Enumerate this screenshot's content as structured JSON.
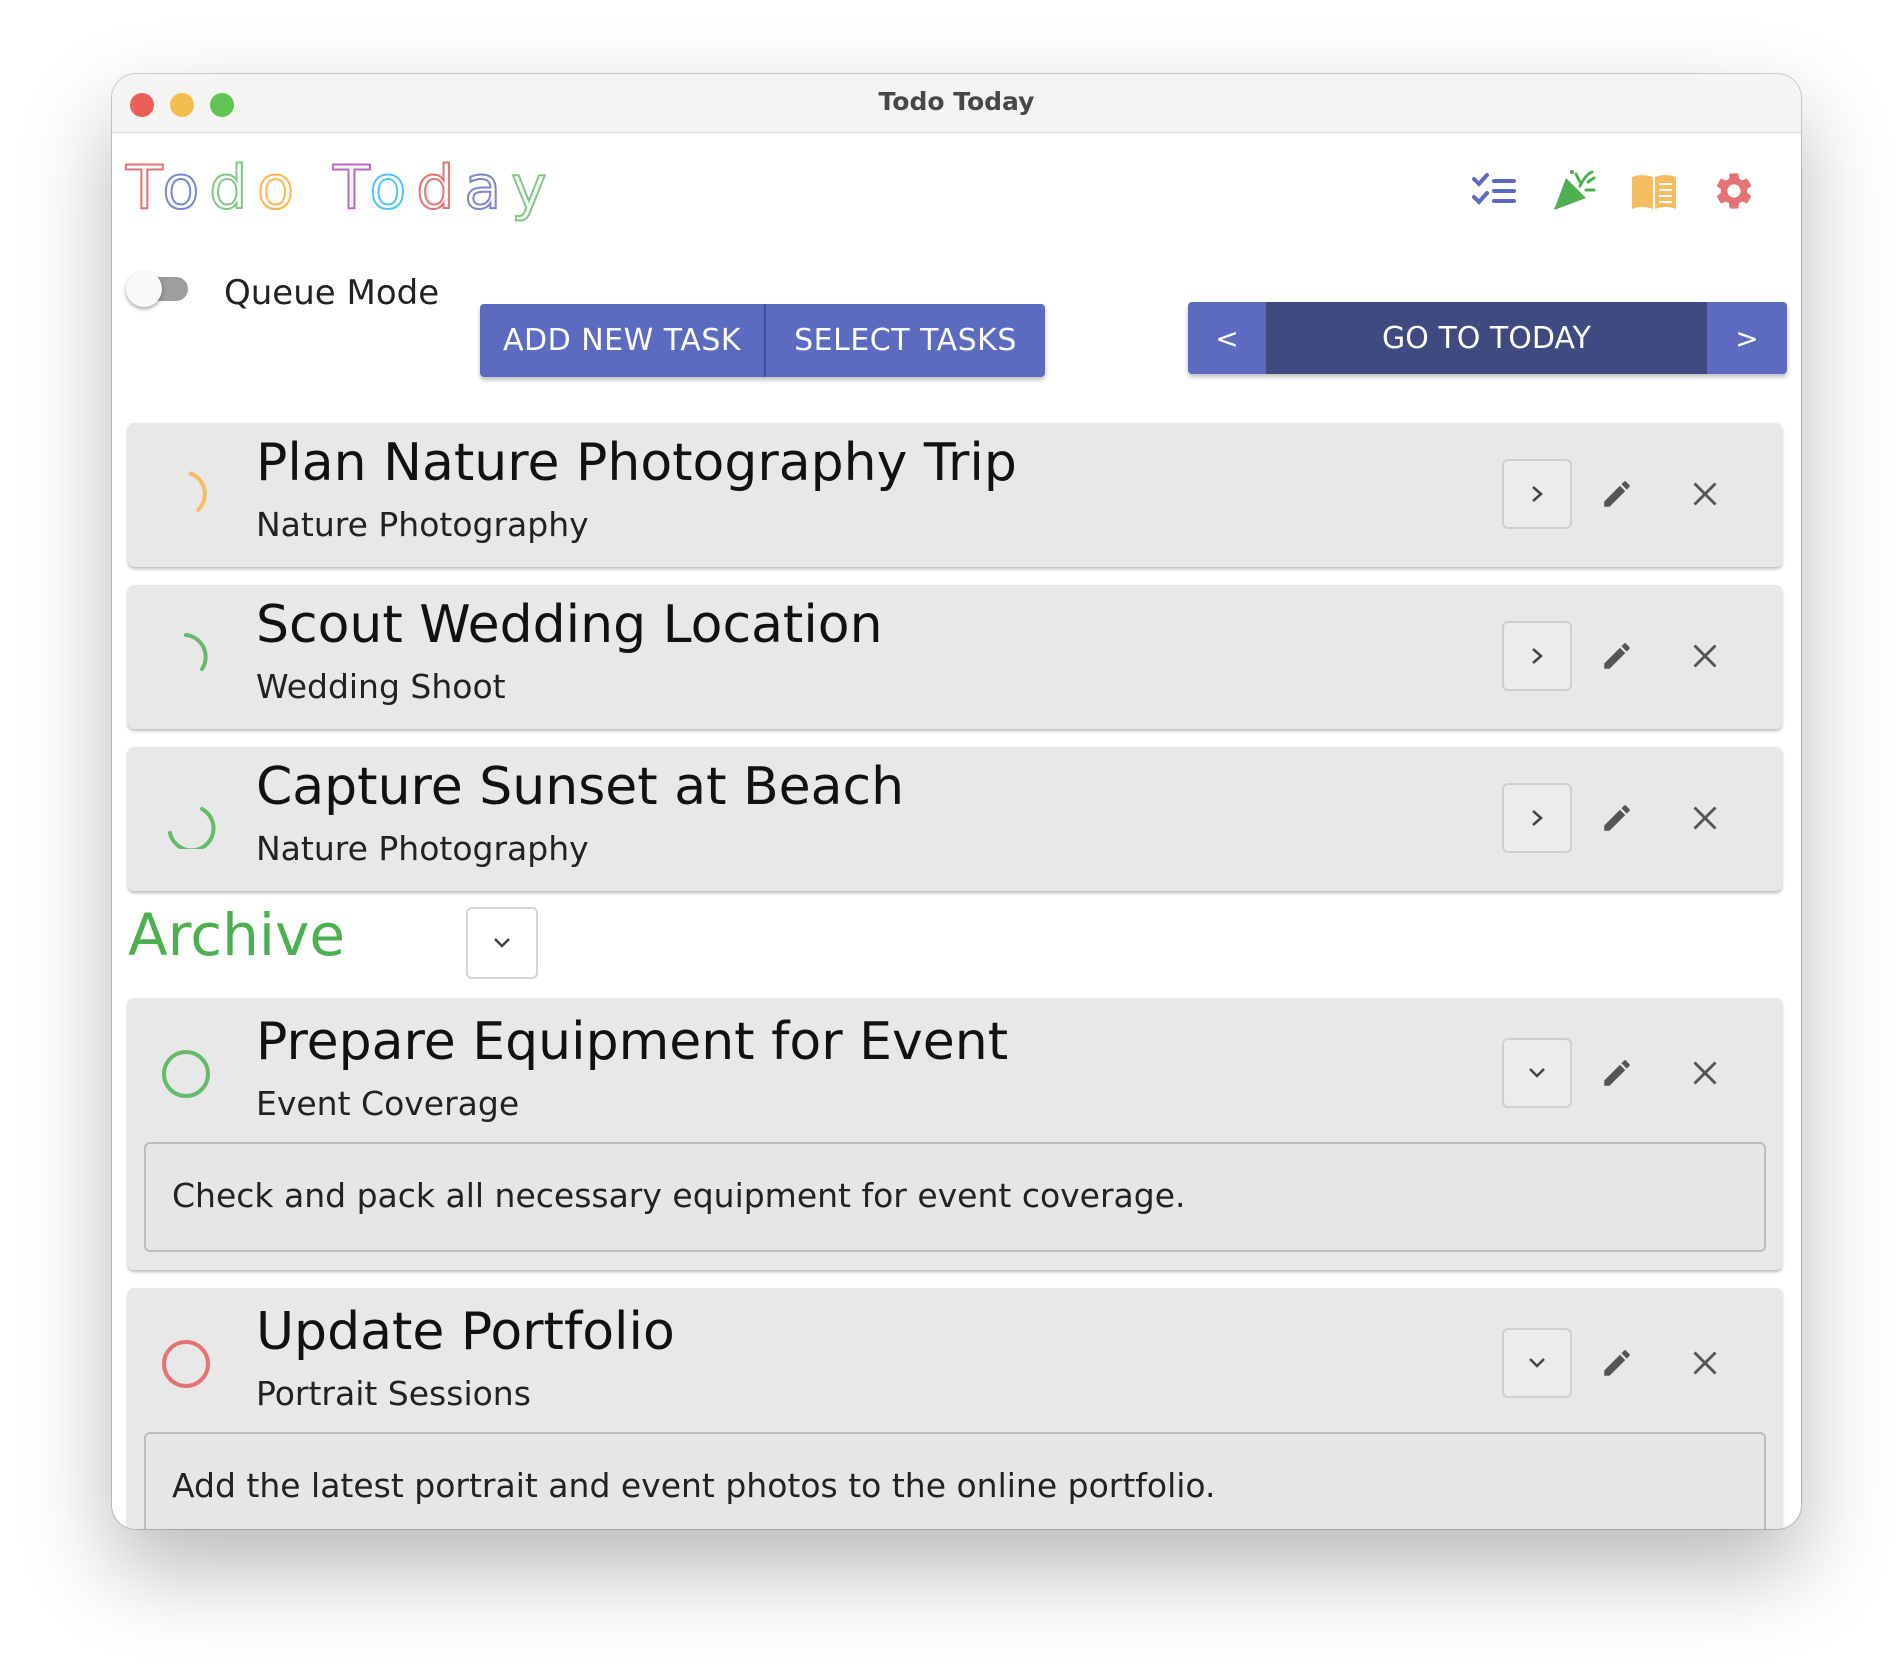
{
  "window": {
    "title": "Todo Today"
  },
  "app": {
    "logo_text": "Todo Today",
    "logo_colors": [
      "#e57373",
      "#7986cb",
      "#81c784",
      "#ffb74d",
      "#ba68c8",
      "#4fc3f7"
    ]
  },
  "header_icons": [
    {
      "name": "checklist-icon",
      "color": "#5c6bc0"
    },
    {
      "name": "party-popper-icon",
      "color": "#4caf50"
    },
    {
      "name": "book-icon",
      "color": "#f6bd60"
    },
    {
      "name": "gear-icon",
      "color": "#e57373"
    }
  ],
  "toolbar": {
    "queue_mode_label": "Queue Mode",
    "queue_mode_on": false,
    "add_task_label": "ADD NEW TASK",
    "select_tasks_label": "SELECT TASKS",
    "prev_label": "<",
    "today_label": "GO TO TODAY",
    "next_label": ">"
  },
  "tasks": [
    {
      "title": "Plan Nature Photography Trip",
      "project": "Nature Photography",
      "status": "in-progress",
      "progress_color": "#f6bd60",
      "progress": 0.15
    },
    {
      "title": "Scout Wedding Location",
      "project": "Wedding Shoot",
      "status": "in-progress",
      "progress_color": "#66bb6a",
      "progress": 0.2
    },
    {
      "title": "Capture Sunset at Beach",
      "project": "Nature Photography",
      "status": "in-progress",
      "progress_color": "#66bb6a",
      "progress": 0.45
    }
  ],
  "archive": {
    "label": "Archive",
    "label_color": "#4caf50",
    "tasks": [
      {
        "title": "Prepare Equipment for Event",
        "project": "Event Coverage",
        "status_color": "#66bb6a",
        "description": "Check and pack all necessary equipment for event coverage."
      },
      {
        "title": "Update Portfolio",
        "project": "Portrait Sessions",
        "status_color": "#e57373",
        "description": "Add the latest portrait and event photos to the online portfolio."
      }
    ]
  }
}
